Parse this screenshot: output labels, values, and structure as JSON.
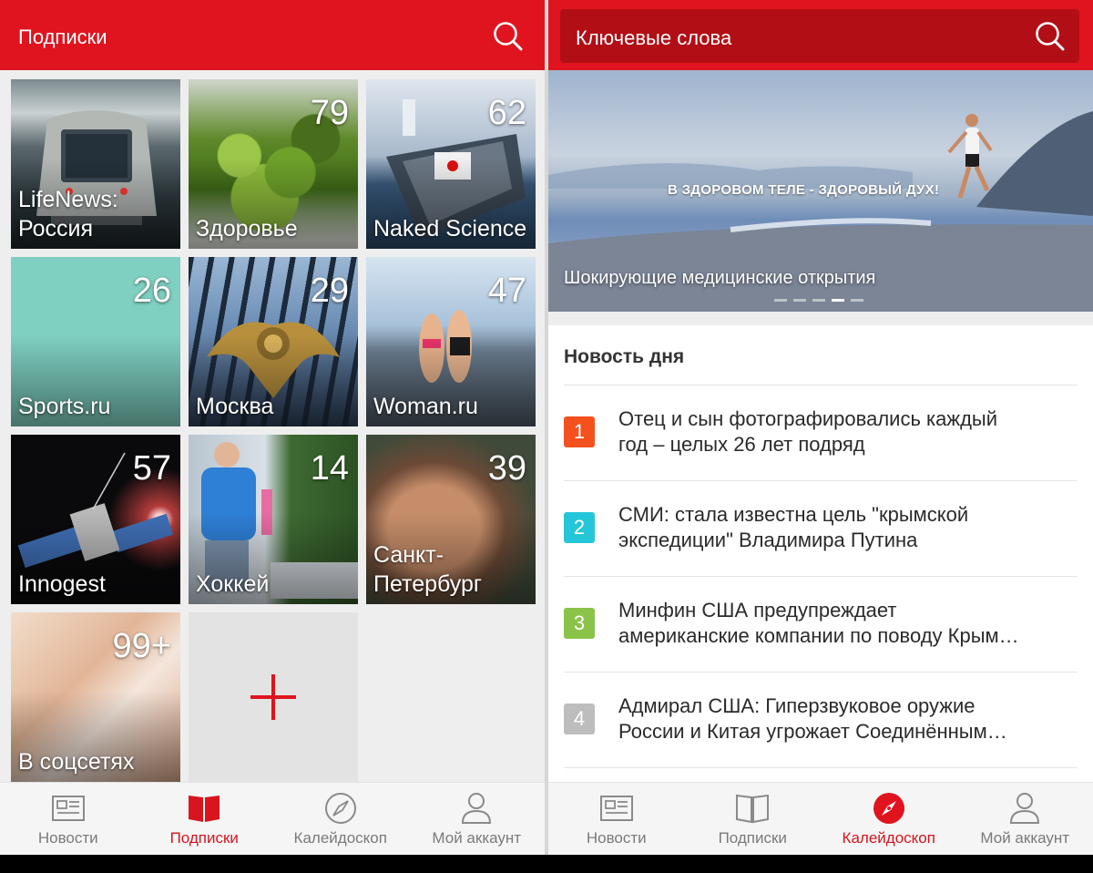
{
  "left": {
    "header": {
      "title": "Подписки"
    },
    "tiles": [
      {
        "label": "LifeNews: Россия",
        "count": ""
      },
      {
        "label": "Здоровье",
        "count": "79"
      },
      {
        "label": "Naked Science",
        "count": "62"
      },
      {
        "label": "Sports.ru",
        "count": "26"
      },
      {
        "label": "Москва",
        "count": "29"
      },
      {
        "label": "Woman.ru",
        "count": "47"
      },
      {
        "label": "Innogest",
        "count": "57"
      },
      {
        "label": "Хоккей",
        "count": "14"
      },
      {
        "label": "Санкт-Петербург",
        "count": "39"
      },
      {
        "label": "В соцсетях",
        "count": "99+"
      }
    ],
    "nav": [
      {
        "label": "Новости",
        "icon": "newspaper-icon"
      },
      {
        "label": "Подписки",
        "icon": "book-icon",
        "active": true
      },
      {
        "label": "Калейдоскоп",
        "icon": "compass-icon"
      },
      {
        "label": "Мой аккаунт",
        "icon": "user-icon"
      }
    ]
  },
  "right": {
    "header": {
      "title": "Ключевые слова"
    },
    "hero": {
      "slogan": "В ЗДОРОВОМ ТЕЛЕ - ЗДОРОВЫЙ ДУХ!",
      "caption": "Шокирующие медицинские открытия",
      "slide_count": 5,
      "active_slide": 4
    },
    "news": {
      "title": "Новость дня",
      "items": [
        {
          "num": "1",
          "color": "#f4511e",
          "line1": "Отец и сын фотографировались каждый",
          "line2": "год – целых 26 лет подряд"
        },
        {
          "num": "2",
          "color": "#26c6da",
          "line1": "СМИ: стала известна цель \"крымской",
          "line2": "экспедиции\" Владимира Путина"
        },
        {
          "num": "3",
          "color": "#8bc34a",
          "line1": "Минфин США предупреждает",
          "line2": "американские компании по поводу Крым…"
        },
        {
          "num": "4",
          "color": "#bdbdbd",
          "line1": "Адмирал США: Гиперзвуковое оружие",
          "line2": "России и Китая угрожает Соединённым…"
        }
      ]
    },
    "nav": [
      {
        "label": "Новости",
        "icon": "newspaper-icon"
      },
      {
        "label": "Подписки",
        "icon": "book-icon"
      },
      {
        "label": "Калейдоскоп",
        "icon": "compass-icon",
        "active": true
      },
      {
        "label": "Мой аккаунт",
        "icon": "user-icon"
      }
    ]
  },
  "colors": {
    "brand_red": "#e0141e",
    "search_box_red": "#b20e15",
    "nav_gray": "#7a7a7a"
  }
}
